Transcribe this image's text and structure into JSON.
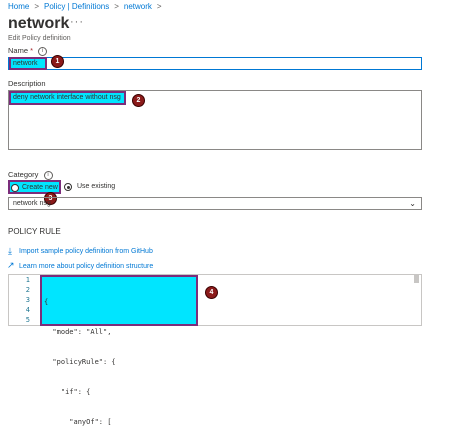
{
  "breadcrumb": [
    "Home",
    "Policy | Definitions",
    "network"
  ],
  "page": {
    "title": "network",
    "subtitle": "Edit Policy definition",
    "more": "···"
  },
  "name_field": {
    "label": "Name",
    "required_mark": "*",
    "value": "network"
  },
  "description_field": {
    "label": "Description",
    "value": "deny network interface without nsg"
  },
  "category": {
    "label": "Category",
    "options": [
      "Create new",
      "Use existing"
    ],
    "selected": "Use existing",
    "select_value": "network nsg"
  },
  "policy_rule": {
    "heading": "POLICY RULE",
    "import_link": "Import sample policy definition from GitHub",
    "learn_link": "Learn more about policy definition structure",
    "line_numbers": [
      "1",
      "2",
      "3",
      "4",
      "5"
    ],
    "code_lines": [
      "{",
      "  \"mode\": \"All\",",
      "  \"policyRule\": {",
      "    \"if\": {",
      "      \"anyOf\": ["
    ]
  },
  "annotations": [
    "1",
    "2",
    "3",
    "4"
  ],
  "colors": {
    "highlight": "#00e5ff",
    "highlight_border": "#7b2d7b",
    "badge": "#8b1a1a",
    "link": "#0078d4"
  }
}
